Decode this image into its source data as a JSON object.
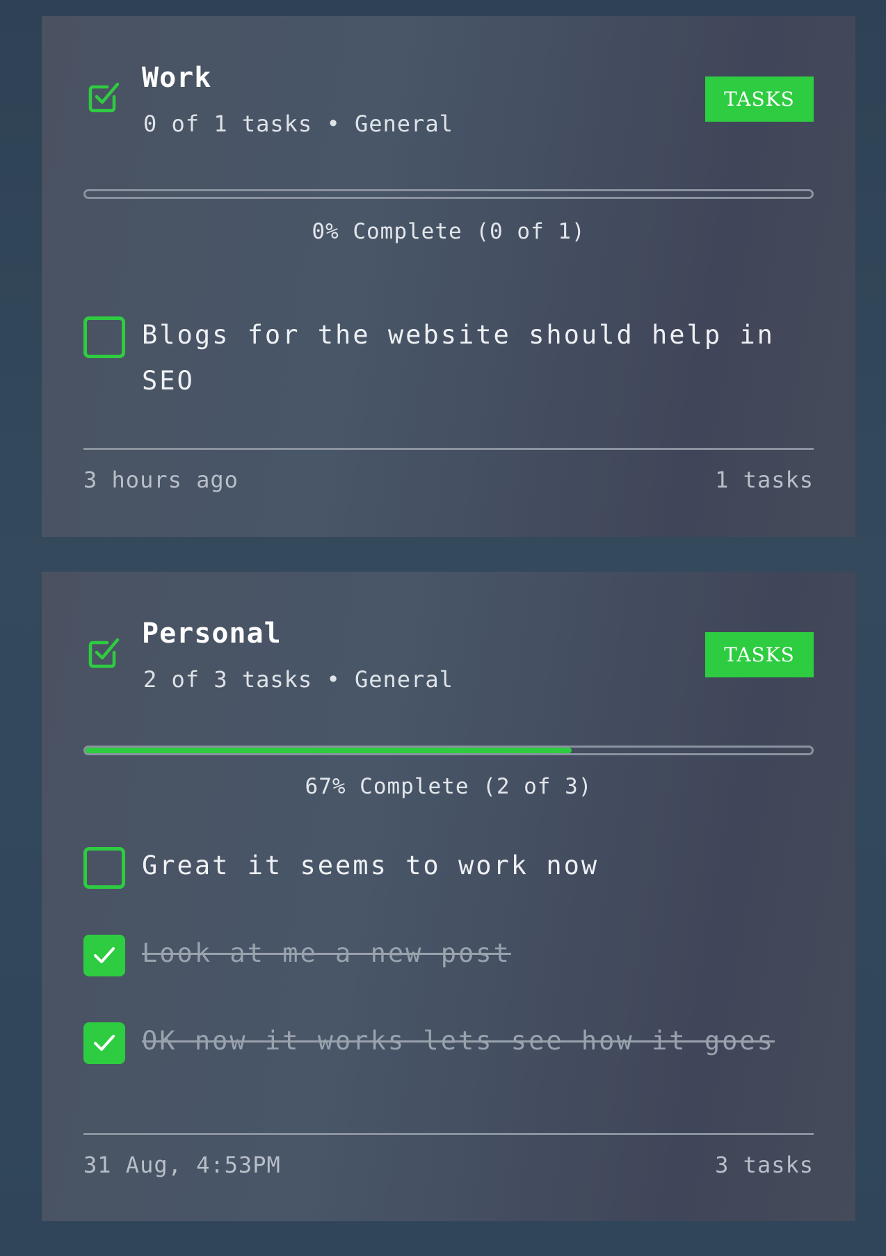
{
  "colors": {
    "accent": "#2ecc40",
    "card_background": "#485668",
    "page_background": "#33475a",
    "track": "#8a939f"
  },
  "cards": [
    {
      "title": "Work",
      "subtitle": "0 of 1 tasks • General",
      "badge": "TASKS",
      "header_icon": "checkbox-checked-outline-icon",
      "progress_percent": 0,
      "progress_label": "0% Complete (0 of 1)",
      "tasks": [
        {
          "text": "Blogs for the website should help in SEO",
          "done": false
        }
      ],
      "footer_left": "3 hours ago",
      "footer_right": "1 tasks"
    },
    {
      "title": "Personal",
      "subtitle": "2 of 3 tasks • General",
      "badge": "TASKS",
      "header_icon": "checkbox-checked-outline-icon",
      "progress_percent": 67,
      "progress_label": "67% Complete (2 of 3)",
      "tasks": [
        {
          "text": "Great it seems to work now",
          "done": false
        },
        {
          "text": "Look at me a new post",
          "done": true
        },
        {
          "text": "OK now it works lets see how it goes",
          "done": true
        }
      ],
      "footer_left": "31 Aug, 4:53PM",
      "footer_right": "3 tasks"
    }
  ]
}
